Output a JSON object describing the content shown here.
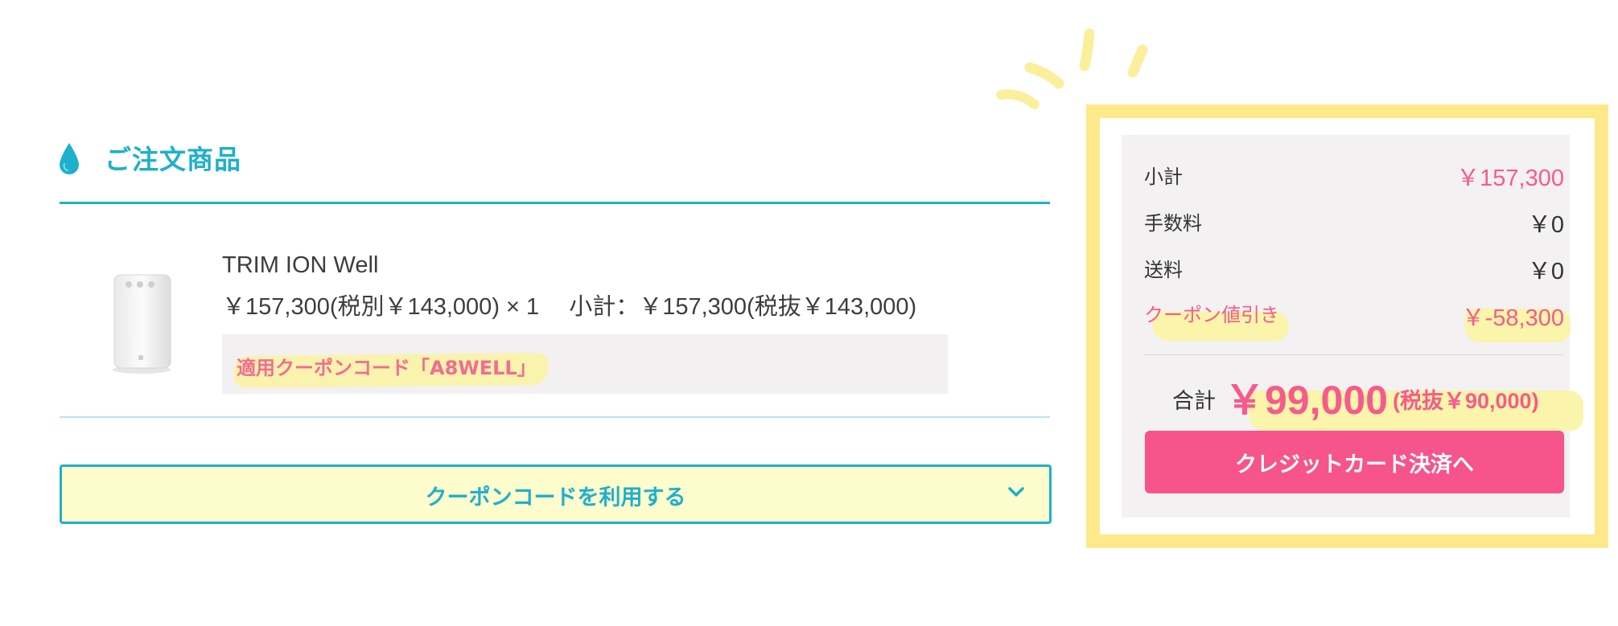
{
  "section": {
    "title": "ご注文商品"
  },
  "product": {
    "name": "TRIM ION Well",
    "price_line": "￥157,300(税別￥143,000) × 1　 小計：￥157,300(税抜￥143,000)",
    "applied_coupon": "適用クーポンコード「A8WELL」"
  },
  "coupon_button": {
    "label": "クーポンコードを利用する"
  },
  "summary": {
    "subtotal_label": "小計",
    "subtotal_value": "￥157,300",
    "fee_label": "手数料",
    "fee_value": "￥0",
    "shipping_label": "送料",
    "shipping_value": "￥0",
    "discount_label": "クーポン値引き",
    "discount_value": "￥-58,300",
    "total_label": "合計",
    "total_value": "￥99,000",
    "total_tax": "(税抜￥90,000)",
    "pay_button_label": "クレジットカード決済へ"
  },
  "colors": {
    "accent_blue": "#1fb0cc",
    "accent_pink": "#f65b8c",
    "highlight_yellow": "#fde98a",
    "coupon_button_bg": "#fdfccd"
  },
  "icons": {
    "section_icon": "water-drop-icon",
    "coupon_toggle": "chevron-down-icon"
  }
}
